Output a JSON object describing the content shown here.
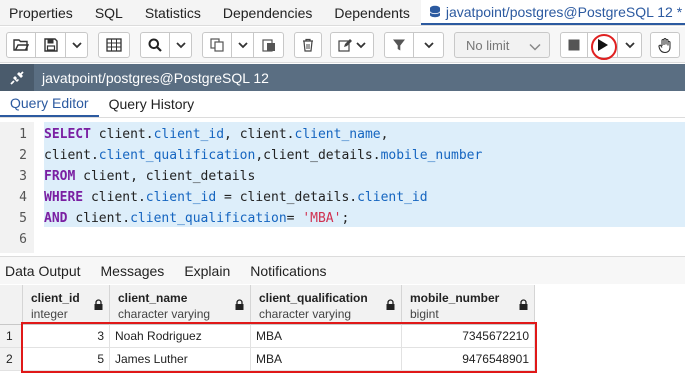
{
  "tabs": [
    {
      "label": "Properties"
    },
    {
      "label": "SQL"
    },
    {
      "label": "Statistics"
    },
    {
      "label": "Dependencies"
    },
    {
      "label": "Dependents"
    },
    {
      "label": "javatpoint/postgres@PostgreSQL 12 *",
      "icon": "database-icon",
      "active": true
    }
  ],
  "toolbar": {
    "limit_label": "No limit",
    "icons": [
      "open-file-icon",
      "save-icon",
      "save-menu-chevron-icon",
      "query-grid-icon",
      "find-icon",
      "find-menu-chevron-icon",
      "copy-icon",
      "copy-menu-chevron-icon",
      "paste-icon",
      "delete-icon",
      "edit-icon",
      "edit-menu-chevron-icon",
      "filter-icon",
      "filter-menu-chevron-icon",
      "stop-icon",
      "execute-icon",
      "execute-menu-chevron-icon",
      "hand-icon"
    ]
  },
  "connection": {
    "label": "javatpoint/postgres@PostgreSQL 12",
    "icon": "plug-icon"
  },
  "editor_tabs": [
    {
      "label": "Query Editor",
      "active": true
    },
    {
      "label": "Query History"
    }
  ],
  "code_lines": [
    {
      "n": "1",
      "text": "SELECT client.client_id, client.client_name,"
    },
    {
      "n": "2",
      "text": "client.client_qualification,client_details.mobile_number"
    },
    {
      "n": "3",
      "text": "FROM client, client_details"
    },
    {
      "n": "4",
      "text": "WHERE client.client_id = client_details.client_id"
    },
    {
      "n": "5",
      "text": "AND client.client_qualification= 'MBA';"
    },
    {
      "n": "6",
      "text": ""
    }
  ],
  "output_tabs": [
    {
      "label": "Data Output",
      "active": true
    },
    {
      "label": "Messages"
    },
    {
      "label": "Explain"
    },
    {
      "label": "Notifications"
    }
  ],
  "grid": {
    "columns": [
      {
        "name": "client_id",
        "type": "integer"
      },
      {
        "name": "client_name",
        "type": "character varying"
      },
      {
        "name": "client_qualification",
        "type": "character varying"
      },
      {
        "name": "mobile_number",
        "type": "bigint"
      }
    ],
    "rows": [
      {
        "n": "1",
        "cells": [
          "3",
          "Noah Rodriguez",
          "MBA",
          "7345672210"
        ]
      },
      {
        "n": "2",
        "cells": [
          "5",
          "James Luther",
          "MBA",
          "9476548901"
        ]
      }
    ]
  },
  "colors": {
    "accent": "#2c5aa0",
    "connection_bar": "#5a6e82",
    "keyword": "#7a1fa2",
    "identifier": "#1565c0",
    "string": "#d03050",
    "highlight_box": "#e01818"
  }
}
